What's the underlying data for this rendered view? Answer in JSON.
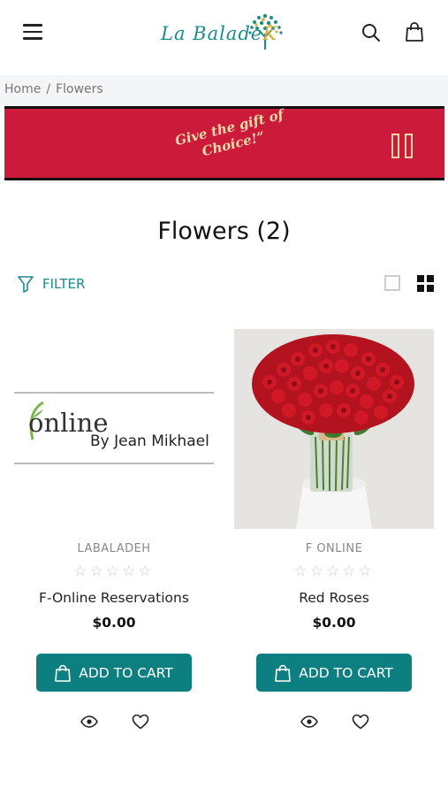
{
  "header": {
    "logo_text_part1": "La Balade",
    "logo_text_part2": "K",
    "menu_icon": "hamburger-icon",
    "search_icon": "search-icon",
    "cart_icon": "shopping-bag-icon"
  },
  "breadcrumb": {
    "home": "Home",
    "separator": "/",
    "current": "Flowers"
  },
  "banner": {
    "line1": "Give the gift of",
    "line2": "Choice!”",
    "background": "#cc1a3a",
    "control_icon": "pause-icon"
  },
  "page": {
    "title": "Flowers (2)"
  },
  "toolbar": {
    "filter_label": "FILTER",
    "accent": "#1b8b8f"
  },
  "products": [
    {
      "brand": "LABALADEH",
      "name": "F-Online Reservations",
      "price": "$0.00",
      "rating": 0,
      "max_rating": 5,
      "cart_label": "ADD TO CART",
      "image_text_1": "online",
      "image_text_2": "By Jean Mikhael"
    },
    {
      "brand": "F ONLINE",
      "name": "Red Roses",
      "price": "$0.00",
      "rating": 0,
      "max_rating": 5,
      "cart_label": "ADD TO CART"
    }
  ],
  "colors": {
    "button": "#0e7f80",
    "star_empty": "#cccccc"
  }
}
